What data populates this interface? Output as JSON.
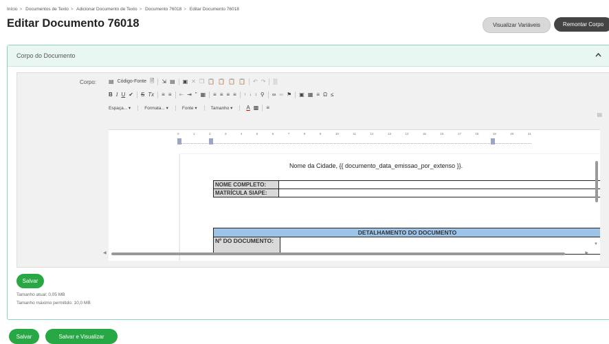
{
  "breadcrumb": {
    "items": [
      "Início",
      "Documentos de Texto",
      "Adicionar Documento de Texto",
      "Documento 76018",
      "Editar Documento 76018"
    ],
    "separator": ">"
  },
  "page": {
    "title": "Editar Documento 76018"
  },
  "header_buttons": {
    "visualizar": "Visualizar Variáveis",
    "remontar": "Remontar Corpo"
  },
  "panel": {
    "title": "Corpo do Documento",
    "collapse_icon": "chevron-up-icon"
  },
  "editor": {
    "label": "Corpo:",
    "source_button": "Código-Fonte",
    "toolbar_row2": [
      "B",
      "I",
      "U",
      "S",
      "Tx"
    ],
    "format_combos": [
      "Espaça...",
      "Formata...",
      "Fonte",
      "Tamanho"
    ],
    "ruler_numbers": [
      "0",
      "1",
      "2",
      "3",
      "4",
      "5",
      "6",
      "7",
      "8",
      "9",
      "10",
      "11",
      "12",
      "13",
      "14",
      "15",
      "16",
      "17",
      "18",
      "19",
      "20",
      "21"
    ]
  },
  "document": {
    "city_line": "Nome da Cidade, {{ documento_data_emissao_por_extenso }}.",
    "table1": {
      "rows": [
        {
          "label": "NOME COMPLETO:",
          "value": ""
        },
        {
          "label": "MATRÍCULA SIAPE:",
          "value": ""
        }
      ]
    },
    "table2": {
      "header": "DETALHAMENTO DO DOCUMENTO",
      "rows": [
        {
          "label": "Nº DO DOCUMENTO:",
          "value": ""
        }
      ]
    }
  },
  "panel_footer": {
    "save_label": "Salvar",
    "current_size": "Tamanho atual: 0,05 MB",
    "max_size": "Tamanho máximo permitido: 10,0 MB"
  },
  "footer": {
    "save_label": "Salvar",
    "save_view_label": "Salvar e Visualizar"
  },
  "colors": {
    "accent_green": "#28a745",
    "panel_border": "#8ad1c1",
    "panel_header_bg": "#e9f7f3",
    "table_header_blue": "#9dc3e6"
  }
}
